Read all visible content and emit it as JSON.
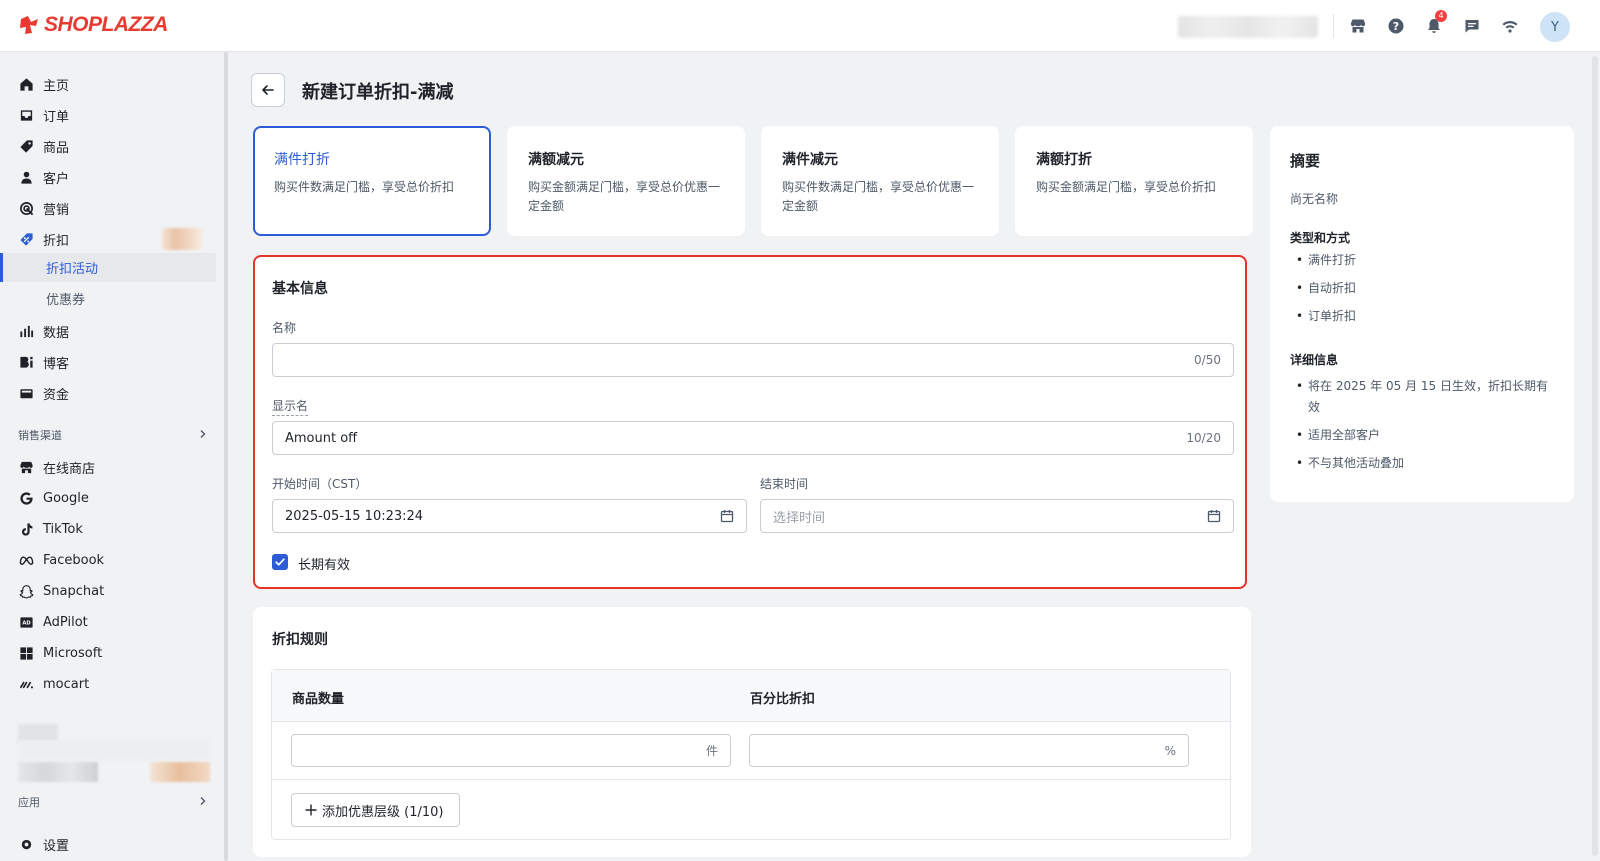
{
  "brand": {
    "name": "SHOPLAZZA",
    "color": "#e83a30"
  },
  "topbar": {
    "icons": [
      "store-icon",
      "help-icon",
      "bell-icon",
      "message-icon",
      "wifi-icon"
    ],
    "notification_count": "4",
    "avatar_initial": "Y"
  },
  "sidebar": {
    "items": [
      {
        "label": "主页",
        "icon": "home-icon"
      },
      {
        "label": "订单",
        "icon": "inbox-icon"
      },
      {
        "label": "商品",
        "icon": "tag-icon"
      },
      {
        "label": "客户",
        "icon": "person-icon"
      },
      {
        "label": "营销",
        "icon": "target-icon"
      },
      {
        "label": "折扣",
        "icon": "discount-icon"
      }
    ],
    "sub_items": [
      {
        "label": "折扣活动",
        "active": true
      },
      {
        "label": "优惠券",
        "active": false
      }
    ],
    "items2": [
      {
        "label": "数据",
        "icon": "bar-chart-icon"
      },
      {
        "label": "博客",
        "icon": "blog-icon"
      },
      {
        "label": "资金",
        "icon": "wallet-icon"
      }
    ],
    "sales_channels_label": "销售渠道",
    "channels": [
      {
        "label": "在线商店",
        "icon": "store-icon"
      },
      {
        "label": "Google",
        "icon": "google-icon"
      },
      {
        "label": "TikTok",
        "icon": "tiktok-icon"
      },
      {
        "label": "Facebook",
        "icon": "meta-icon"
      },
      {
        "label": "Snapchat",
        "icon": "snapchat-icon"
      },
      {
        "label": "AdPilot",
        "icon": "adpilot-icon"
      },
      {
        "label": "Microsoft",
        "icon": "microsoft-icon"
      },
      {
        "label": "mocart",
        "icon": "mocart-icon"
      }
    ],
    "apps_label": "应用",
    "settings_label": "设置"
  },
  "header": {
    "title": "新建订单折扣-满减"
  },
  "type_cards": [
    {
      "title": "满件打折",
      "desc": "购买件数满足门槛，享受总价折扣",
      "active": true
    },
    {
      "title": "满额减元",
      "desc": "购买金额满足门槛，享受总价优惠一定金额",
      "active": false
    },
    {
      "title": "满件减元",
      "desc": "购买件数满足门槛，享受总价优惠一定金额",
      "active": false
    },
    {
      "title": "满额打折",
      "desc": "购买金额满足门槛，享受总价折扣",
      "active": false
    }
  ],
  "basic_info": {
    "title": "基本信息",
    "name_label": "名称",
    "name_value": "",
    "name_counter": "0/50",
    "display_label": "显示名",
    "display_value": "Amount off",
    "display_counter": "10/20",
    "start_label": "开始时间（CST）",
    "start_value": "2025-05-15 10:23:24",
    "end_label": "结束时间",
    "end_placeholder": "选择时间",
    "long_term_label": "长期有效",
    "long_term_checked": true
  },
  "rules": {
    "title": "折扣规则",
    "col_qty": "商品数量",
    "col_pct": "百分比折扣",
    "qty_unit": "件",
    "pct_unit": "%",
    "add_tier_label": "添加优惠层级 (1/10)"
  },
  "summary": {
    "title": "摘要",
    "name_text": "尚无名称",
    "type_heading": "类型和方式",
    "type_items": [
      "满件打折",
      "自动折扣",
      "订单折扣"
    ],
    "detail_heading": "详细信息",
    "detail_items": [
      "将在 2025 年 05 月 15 日生效，折扣长期有效",
      "适用全部客户",
      "不与其他活动叠加"
    ]
  },
  "colors": {
    "accent": "#2d5cd7",
    "highlight_border": "#e5332a"
  }
}
